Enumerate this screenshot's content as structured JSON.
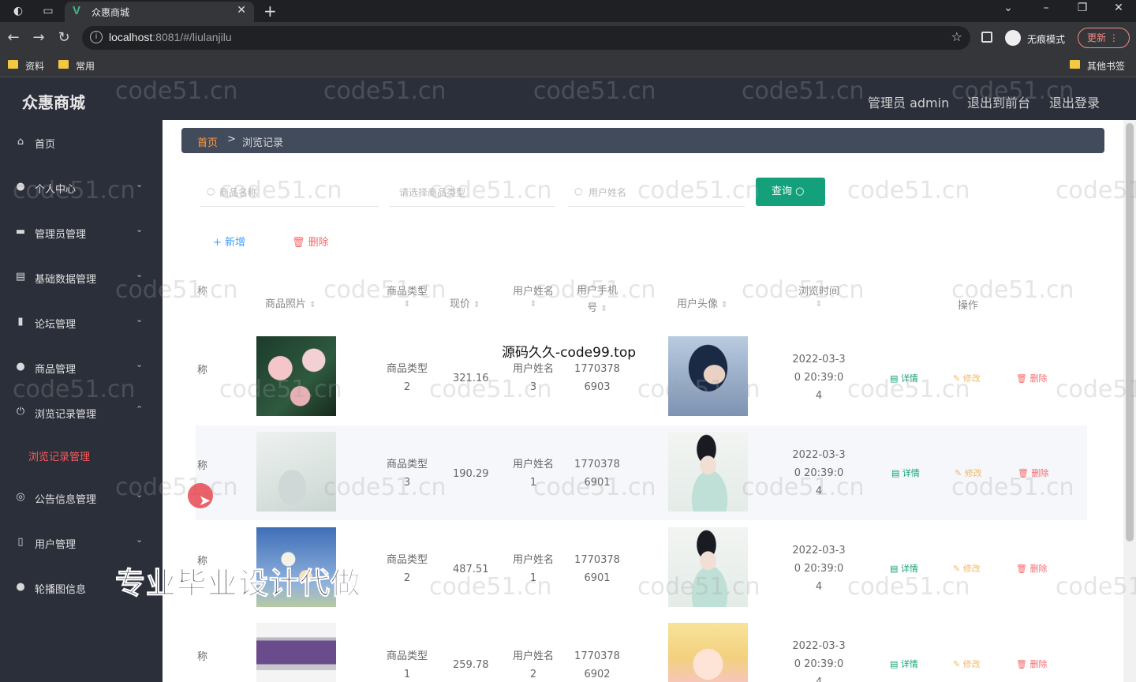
{
  "browser": {
    "tab_title": "众惠商城",
    "url_host": "localhost",
    "url_rest": ":8081/#/liulanjilu",
    "incognito_label": "无痕模式",
    "update_label": "更新",
    "bookmarks": [
      "资料",
      "常用"
    ],
    "other_bookmarks": "其他书签"
  },
  "header": {
    "logo": "众惠商城",
    "admin": "管理员 admin",
    "back_front": "退出到前台",
    "logout": "退出登录"
  },
  "sidebar": {
    "items": [
      {
        "label": "首页",
        "icon": "home-icon"
      },
      {
        "label": "个人中心",
        "icon": "user-icon"
      },
      {
        "label": "管理员管理",
        "icon": "card-icon"
      },
      {
        "label": "基础数据管理",
        "icon": "document-icon"
      },
      {
        "label": "论坛管理",
        "icon": "bar-chart-icon"
      },
      {
        "label": "商品管理",
        "icon": "user-icon"
      },
      {
        "label": "浏览记录管理",
        "icon": "power-icon"
      },
      {
        "label": "公告信息管理",
        "icon": "globe-icon"
      },
      {
        "label": "用户管理",
        "icon": "phone-icon"
      },
      {
        "label": "轮播图信息",
        "icon": "user-icon"
      }
    ],
    "active_sub": "浏览记录管理"
  },
  "breadcrumb": {
    "home": "首页",
    "current": "浏览记录"
  },
  "search": {
    "name_placeholder": "商品名称",
    "type_placeholder": "请选择商品类型",
    "user_placeholder": "用户姓名",
    "query_label": "查询"
  },
  "actions": {
    "add": "新增",
    "delete": "删除"
  },
  "table": {
    "headers": {
      "name": "称",
      "photo": "商品照片",
      "type": "商品类型",
      "price": "现价",
      "username": "用户姓名",
      "phone": "用户手机号",
      "avatar": "用户头像",
      "time": "浏览时间",
      "ops": "操作"
    },
    "rows": [
      {
        "name": "称",
        "type": "商品类型2",
        "price": "321.16",
        "username": "用户姓名3",
        "phone": "17703786903",
        "time": "2022-03-30 20:39:04"
      },
      {
        "name": "称",
        "type": "商品类型3",
        "price": "190.29",
        "username": "用户姓名1",
        "phone": "17703786901",
        "time": "2022-03-30 20:39:04"
      },
      {
        "name": "称",
        "type": "商品类型2",
        "price": "487.51",
        "username": "用户姓名1",
        "phone": "17703786901",
        "time": "2022-03-30 20:39:04"
      },
      {
        "name": "称",
        "type": "商品类型1",
        "price": "259.78",
        "username": "用户姓名2",
        "phone": "17703786902",
        "time": "2022-03-30 20:39:04"
      }
    ],
    "op_labels": {
      "detail": "详情",
      "edit": "修改",
      "remove": "删除"
    }
  },
  "overlays": {
    "watermark": "code51.cn",
    "center": "源码久久-code99.top",
    "promo": "专业毕业设计代做"
  },
  "colors": {
    "accent": "#13a07a",
    "danger": "#f56c6c",
    "brand_orange": "#ff9a3c"
  }
}
